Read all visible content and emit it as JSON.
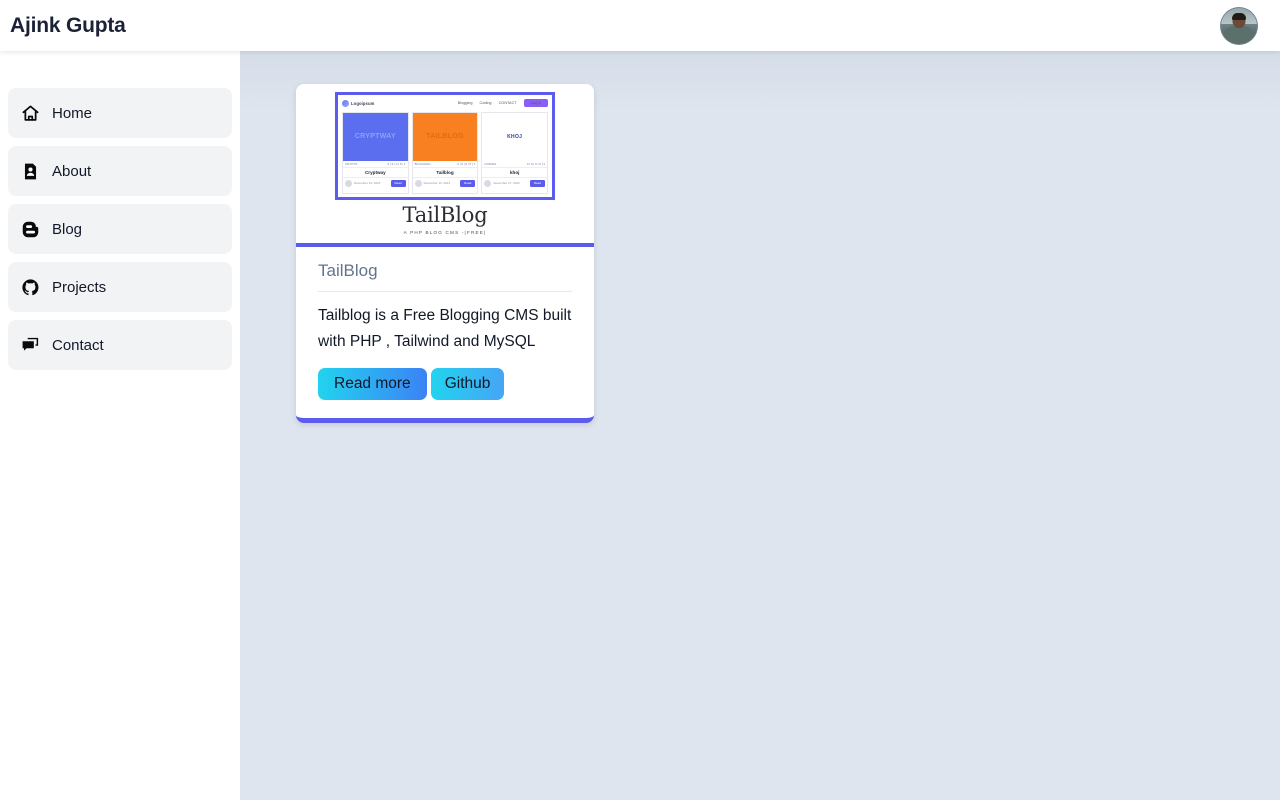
{
  "header": {
    "title": "Ajink Gupta",
    "avatar_name": "user-avatar"
  },
  "sidebar": {
    "items": [
      {
        "label": "Home",
        "icon": "home-icon"
      },
      {
        "label": "About",
        "icon": "person-document-icon"
      },
      {
        "label": "Blog",
        "icon": "blogger-icon"
      },
      {
        "label": "Projects",
        "icon": "github-icon"
      },
      {
        "label": "Contact",
        "icon": "chat-bubbles-icon"
      }
    ]
  },
  "main": {
    "cards": [
      {
        "title": "TailBlog",
        "description": "Tailblog is a Free Blogging CMS built with PHP , Tailwind and MySQL",
        "read_more_label": "Read more",
        "github_label": "Github",
        "thumbnail": {
          "brand": "TailBlog",
          "tagline": "A PHP BLOG CMS -|FREE|",
          "nav": {
            "logo": "Logoipsum",
            "links": [
              "Blogging",
              "Coding",
              "CONTACT"
            ],
            "button": "Log in"
          },
          "posts": [
            {
              "hero_text": "CRYPTWAY",
              "category": "CRYPTO",
              "stats": "0 | 5 | 0 | 5 | 1",
              "title": "Cryptway",
              "date": "December 13, 2023",
              "button": "Read"
            },
            {
              "hero_text": "TAILBLOG",
              "category": "BLOGGING",
              "stats": "0 | 5 | 0 | 5 | 1",
              "title": "Tailblog",
              "date": "December 13, 2023",
              "button": "Read"
            },
            {
              "hero_text": "KHOJ",
              "category": "CODING",
              "stats": "0 | 5 | 0 | 5 | 1",
              "title": "khoj",
              "date": "December 27, 2023",
              "button": "Read"
            }
          ]
        }
      }
    ]
  },
  "colors": {
    "accent_indigo": "#5b5bec",
    "btn_gradient_start": "#22d3ee",
    "btn_gradient_end": "#3b82f6",
    "page_background": "#dfe5ee",
    "sidebar_item_background": "#f2f3f5"
  }
}
